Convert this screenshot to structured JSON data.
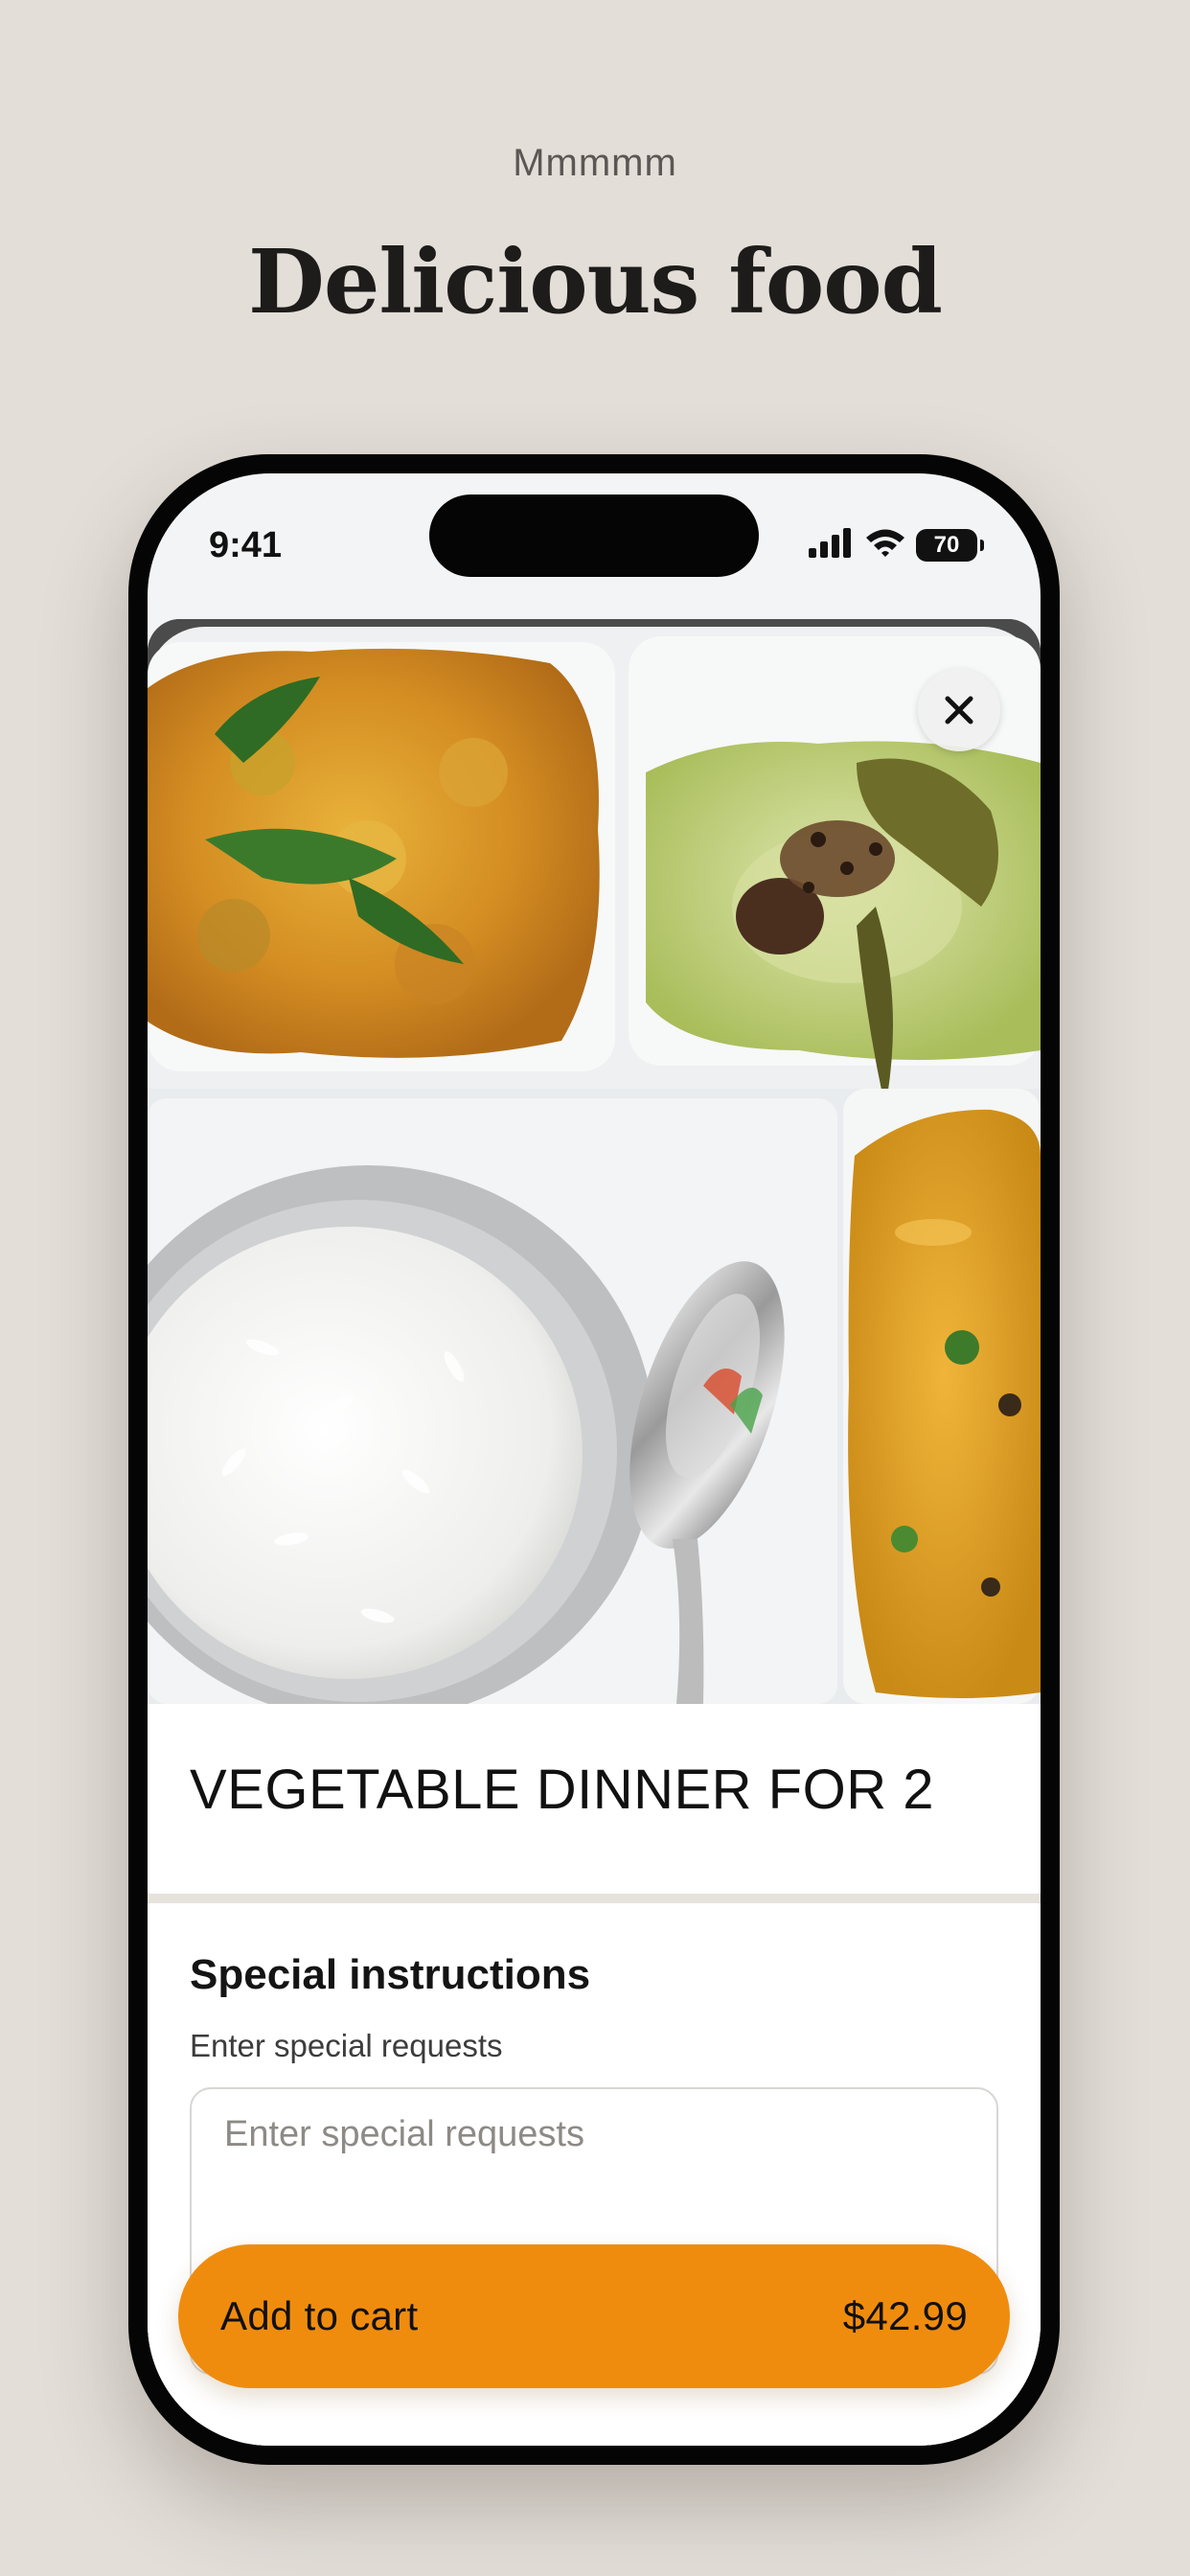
{
  "page": {
    "eyebrow": "Mmmmm",
    "headline": "Delicious food"
  },
  "status_bar": {
    "time": "9:41",
    "battery": "70",
    "icons": [
      "signal-icon",
      "wifi-icon",
      "battery-icon"
    ]
  },
  "item": {
    "title": "VEGETABLE DINNER FOR 2",
    "image": "food-photo"
  },
  "special_instructions": {
    "heading": "Special instructions",
    "label": "Enter special requests",
    "placeholder": "Enter special requests",
    "value": ""
  },
  "cart_button": {
    "label": "Add to cart",
    "price": "$42.99"
  },
  "colors": {
    "background": "#e3ded8",
    "accent": "#f08c0d",
    "divider": "#e6e2dc"
  }
}
